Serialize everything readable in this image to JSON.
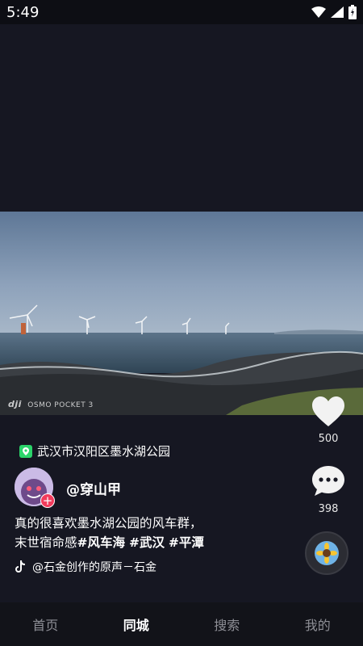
{
  "status_bar": {
    "time": "5:49",
    "icons": [
      "wifi-icon",
      "signal-icon",
      "battery-icon"
    ]
  },
  "video": {
    "watermark_brand": "dji",
    "watermark_model": "OSMO POCKET 3"
  },
  "location": {
    "icon": "location-pin-icon",
    "text": "武汉市汉阳区墨水湖公园",
    "color": "#2bd46a"
  },
  "author": {
    "name": "@穿山甲",
    "follow_badge": "+"
  },
  "caption": {
    "line1": "真的很喜欢墨水湖公园的风车群，",
    "line2_prefix": "末世宿命感",
    "tags": [
      "#风车海",
      "#武汉",
      "#平潭"
    ]
  },
  "music": {
    "icon": "tiktok-note-icon",
    "text": "@石金创作的原声－石金"
  },
  "actions": {
    "like_count": "500",
    "comment_count": "398"
  },
  "nav": {
    "items": [
      "首页",
      "同城",
      "搜索",
      "我的"
    ],
    "active": "同城"
  },
  "colors": {
    "background": "#161722",
    "accent_red": "#f23b5c"
  }
}
